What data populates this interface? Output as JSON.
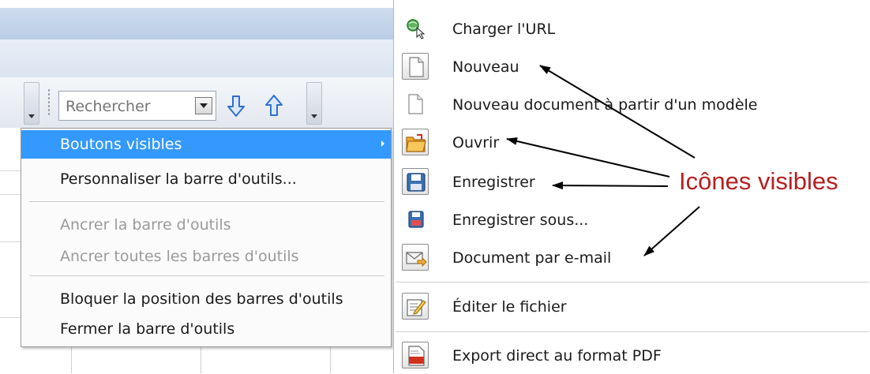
{
  "toolbar": {
    "search_placeholder": "Rechercher"
  },
  "context_menu": {
    "items": [
      {
        "label": "Boutons visibles",
        "state": "highlighted",
        "has_submenu": true
      },
      {
        "label": "Personnaliser la barre d'outils...",
        "state": "enabled"
      },
      {
        "label": "Ancrer la barre d'outils",
        "state": "disabled"
      },
      {
        "label": "Ancrer toutes les barres d'outils",
        "state": "disabled"
      },
      {
        "label": "Bloquer la position des barres d'outils",
        "state": "enabled"
      },
      {
        "label": "Fermer la barre d'outils",
        "state": "enabled"
      }
    ]
  },
  "submenu": {
    "items": [
      {
        "label": "Charger l'URL",
        "icon": "load-url-icon",
        "checked": false
      },
      {
        "label": "Nouveau",
        "icon": "new-document-icon",
        "checked": true
      },
      {
        "label": "Nouveau document à partir d'un modèle",
        "icon": "template-document-icon",
        "checked": false
      },
      {
        "label": "Ouvrir",
        "icon": "open-folder-icon",
        "checked": true
      },
      {
        "label": "Enregistrer",
        "icon": "save-icon",
        "checked": true
      },
      {
        "label": "Enregistrer sous...",
        "icon": "save-as-icon",
        "checked": false
      },
      {
        "label": "Document par e-mail",
        "icon": "email-document-icon",
        "checked": true
      },
      {
        "label": "Éditer le fichier",
        "icon": "edit-file-icon",
        "checked": true
      },
      {
        "label": "Export direct au format PDF",
        "icon": "pdf-export-icon",
        "checked": true
      }
    ]
  },
  "annotation": {
    "label": "Icônes visibles",
    "color": "#b51f1f"
  },
  "colors": {
    "menu_highlight": "#3399ff",
    "disabled_text": "#9a9a9a"
  }
}
